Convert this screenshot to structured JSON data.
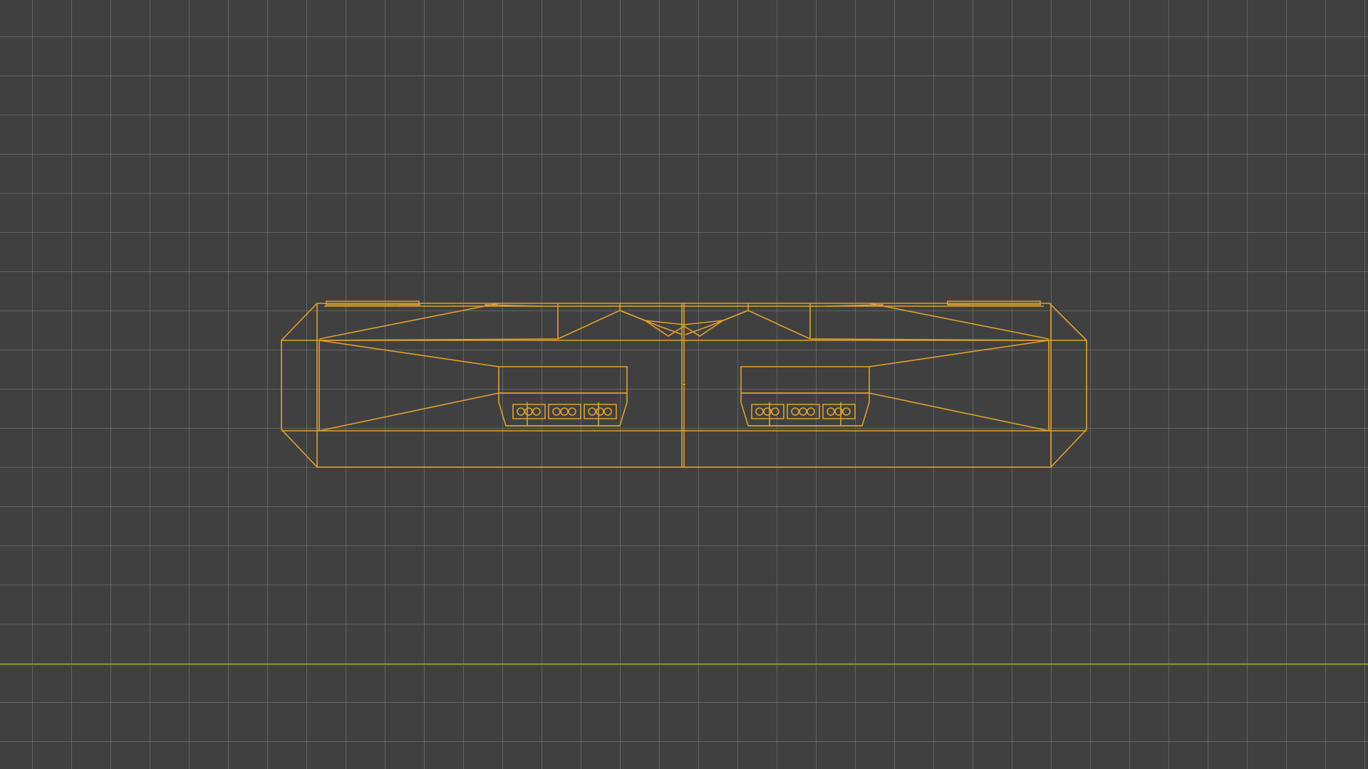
{
  "viewport": {
    "background_color": "#404040",
    "grid_color": "#8c8c8c",
    "axis_x_color": "#7a8a3a"
  },
  "object": {
    "wire_color": "#e0a030",
    "selected": true,
    "origin_marker": "object-origin-dot"
  }
}
